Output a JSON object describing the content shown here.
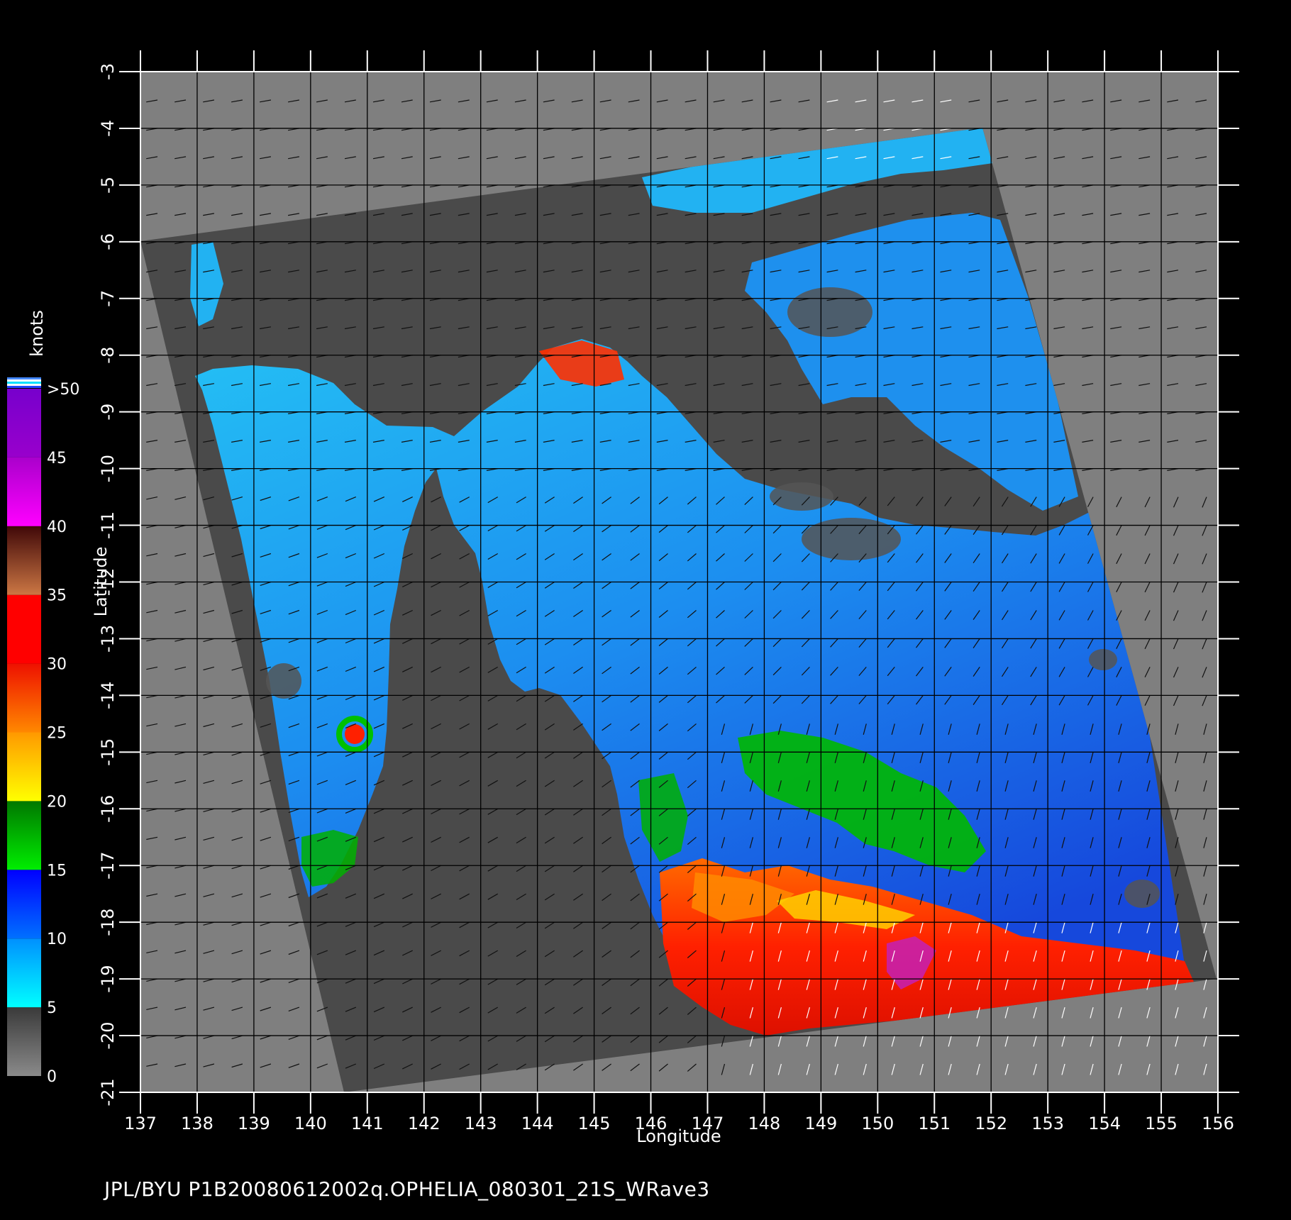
{
  "caption": "JPL/BYU  P1B20080612002q.OPHELIA_080301_21S_WRave3",
  "axes": {
    "x_label": "Longitude",
    "y_label": "Latitude",
    "x_ticks": [
      "137",
      "138",
      "139",
      "140",
      "141",
      "142",
      "143",
      "144",
      "145",
      "146",
      "147",
      "148",
      "149",
      "150",
      "151",
      "152",
      "153",
      "154",
      "155",
      "156"
    ],
    "y_ticks": [
      "-3",
      "-4",
      "-5",
      "-6",
      "-7",
      "-8",
      "-9",
      "-10",
      "-11",
      "-12",
      "-13",
      "-14",
      "-15",
      "-16",
      "-17",
      "-18",
      "-19",
      "-20",
      "-21"
    ],
    "xlim": [
      137,
      156
    ],
    "ylim": [
      -21,
      -3
    ],
    "grid": true
  },
  "colorbar": {
    "title": "knots",
    "labels": [
      "0",
      "5",
      "10",
      "15",
      "20",
      "25",
      "30",
      "35",
      "40",
      "45",
      ">50"
    ],
    "segments": [
      {
        "from": 0,
        "to": 5,
        "top": "#3a3a3a",
        "bottom": "#8a8a8a"
      },
      {
        "from": 5,
        "to": 10,
        "top": "#0090ff",
        "bottom": "#00ffff"
      },
      {
        "from": 10,
        "to": 15,
        "top": "#0000ff",
        "bottom": "#0070ff"
      },
      {
        "from": 15,
        "to": 20,
        "top": "#007700",
        "bottom": "#00ee00"
      },
      {
        "from": 20,
        "to": 25,
        "top": "#ff9900",
        "bottom": "#ffff00"
      },
      {
        "from": 25,
        "to": 30,
        "top": "#ee1100",
        "bottom": "#ff8800"
      },
      {
        "from": 30,
        "to": 35,
        "top": "#ff0000",
        "bottom": "#ff0000"
      },
      {
        "from": 35,
        "to": 40,
        "top": "#400808",
        "bottom": "#cc7744"
      },
      {
        "from": 40,
        "to": 45,
        "top": "#aa00cc",
        "bottom": "#ff00ff"
      },
      {
        "from": 45,
        "to": 50,
        "top": "#7700cc",
        "bottom": "#9900cc"
      }
    ]
  },
  "colors": {
    "background": "#000000",
    "outside_swath": "#7f7f7f",
    "land": "#4a4a4a",
    "ocean_light": "#20b4f0",
    "ocean_mid": "#1a7ae8",
    "ocean_deep": "#1438d8",
    "high_wind": "#ff2a00",
    "moderate_wind": "#00c000",
    "grid": "#000000",
    "text": "#ffffff"
  }
}
